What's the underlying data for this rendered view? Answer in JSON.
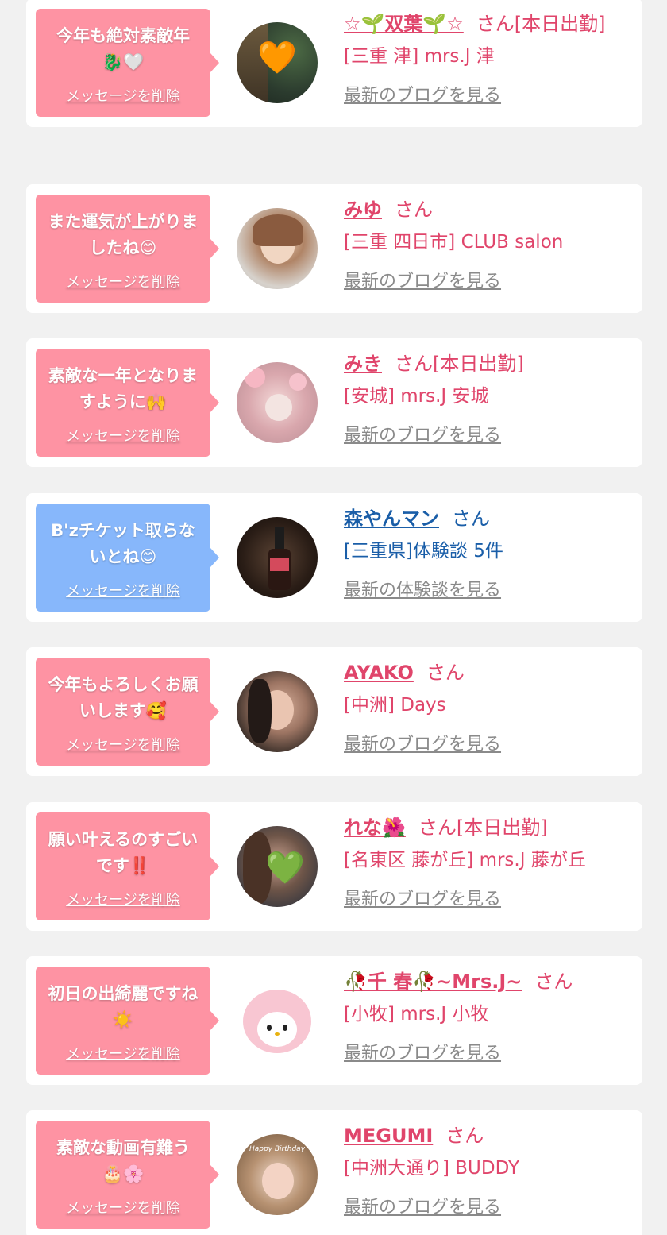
{
  "colors": {
    "page_bg": "#f1f1f1",
    "card_bg": "#ffffff",
    "bubble_pink": "#fe93a3",
    "bubble_blue": "#87b7fb",
    "name_pink": "#e0456b",
    "name_blue": "#1a5ea8",
    "link_gray": "#8a8a8a"
  },
  "items": [
    {
      "message": "今年も絶対素敵年🐉🤍",
      "delete_label": "メッセージを削除",
      "name": "☆🌱双葉🌱☆",
      "suffix": "さん[本日出勤]",
      "shop": "[三重 津] mrs.J 津",
      "link": "最新のブログを見る",
      "avatar_icon": "orange-heart-photo-icon",
      "avatar_overlay": "🧡"
    },
    {
      "message": "また運気が上がりましたね😊",
      "delete_label": "メッセージを削除",
      "name": "みゆ",
      "suffix": "さん",
      "shop": "[三重 四日市] CLUB salon",
      "link": "最新のブログを見る",
      "avatar_icon": "woman-portrait-photo-icon",
      "avatar_overlay": ""
    },
    {
      "message": "素敵な一年となりますように🙌",
      "delete_label": "メッセージを削除",
      "name": "みき",
      "suffix": "さん[本日出勤]",
      "shop": "[安城] mrs.J 安城",
      "link": "最新のブログを見る",
      "avatar_icon": "flower-filter-photo-icon",
      "avatar_overlay": ""
    },
    {
      "message": "B'zチケット取らないとね😊",
      "delete_label": "メッセージを削除",
      "name": "森やんマン",
      "suffix": "さん",
      "shop": "[三重県]体験談 5件",
      "link": "最新の体験談を見る",
      "avatar_icon": "champagne-photo-icon",
      "avatar_overlay": ""
    },
    {
      "message": "今年もよろしくお願いします🥰",
      "delete_label": "メッセージを削除",
      "name": "AYAKO",
      "suffix": "さん",
      "shop": "[中洲] Days",
      "link": "最新のブログを見る",
      "avatar_icon": "woman-selfie-photo-icon",
      "avatar_overlay": ""
    },
    {
      "message": "願い叶えるのすごいです‼️",
      "delete_label": "メッセージを削除",
      "name": "れな🌺",
      "suffix": "さん[本日出勤]",
      "shop": "[名東区 藤が丘] mrs.J 藤が丘",
      "link": "最新のブログを見る",
      "avatar_icon": "green-heart-photo-icon",
      "avatar_overlay": "💚"
    },
    {
      "message": "初日の出綺麗ですね☀️",
      "delete_label": "メッセージを削除",
      "name": "🥀千 春🥀~Mrs.J~",
      "suffix": "さん",
      "shop": "[小牧] mrs.J 小牧",
      "link": "最新のブログを見る",
      "avatar_icon": "my-melody-plush-photo-icon",
      "avatar_overlay": ""
    },
    {
      "message": "素敵な動画有難う🎂🌸",
      "delete_label": "メッセージを削除",
      "name": "MEGUMI",
      "suffix": "さん",
      "shop": "[中洲大通り] BUDDY",
      "link": "最新のブログを見る",
      "avatar_icon": "birthday-photo-icon",
      "avatar_overlay": "",
      "avatar_caption": "Happy Birthday"
    }
  ]
}
